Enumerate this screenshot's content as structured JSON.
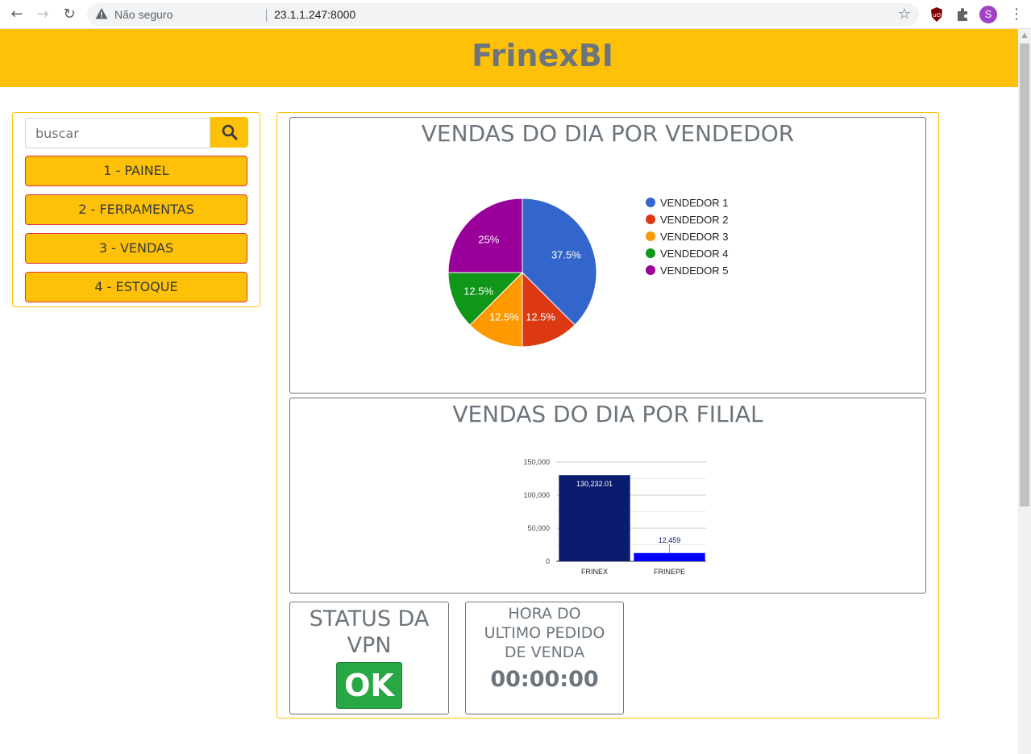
{
  "browser": {
    "security_label": "Não seguro",
    "url": "23.1.1.247:8000",
    "profile_initial": "S"
  },
  "header": {
    "title": "FrinexBI"
  },
  "sidebar": {
    "search_placeholder": "buscar",
    "items": [
      {
        "label": "1 - PAINEL"
      },
      {
        "label": "2 - FERRAMENTAS"
      },
      {
        "label": "3 - VENDAS"
      },
      {
        "label": "4 - ESTOQUE"
      }
    ]
  },
  "pie_card": {
    "title": "VENDAS DO DIA POR VENDEDOR"
  },
  "bar_card": {
    "title": "VENDAS DO DIA POR FILIAL"
  },
  "vpn": {
    "title": "STATUS DA VPN",
    "status": "OK"
  },
  "last_order": {
    "title": "HORA DO ULTIMO PEDIDO DE VENDA",
    "time": "00:00:00"
  },
  "chart_data": [
    {
      "type": "pie",
      "title": "VENDAS DO DIA POR VENDEDOR",
      "categories": [
        "VENDEDOR 1",
        "VENDEDOR 2",
        "VENDEDOR 3",
        "VENDEDOR 4",
        "VENDEDOR 5"
      ],
      "values": [
        37.5,
        12.5,
        12.5,
        12.5,
        25
      ],
      "labels": [
        "37.5%",
        "12.5%",
        "12.5%",
        "12.5%",
        "25%"
      ],
      "colors": [
        "#3366cc",
        "#dc3912",
        "#ff9900",
        "#109618",
        "#990099"
      ],
      "legend": "right"
    },
    {
      "type": "bar",
      "title": "VENDAS DO DIA POR FILIAL",
      "categories": [
        "FRINEX",
        "FRINEPE"
      ],
      "values": [
        130232.01,
        12459
      ],
      "labels": [
        "130,232.01",
        "12,459"
      ],
      "colors": [
        "#0b1c6e",
        "#0000ff"
      ],
      "ylim": [
        0,
        150000
      ],
      "yticks": [
        "0",
        "50,000",
        "100,000",
        "150,000"
      ],
      "grid": true
    }
  ]
}
